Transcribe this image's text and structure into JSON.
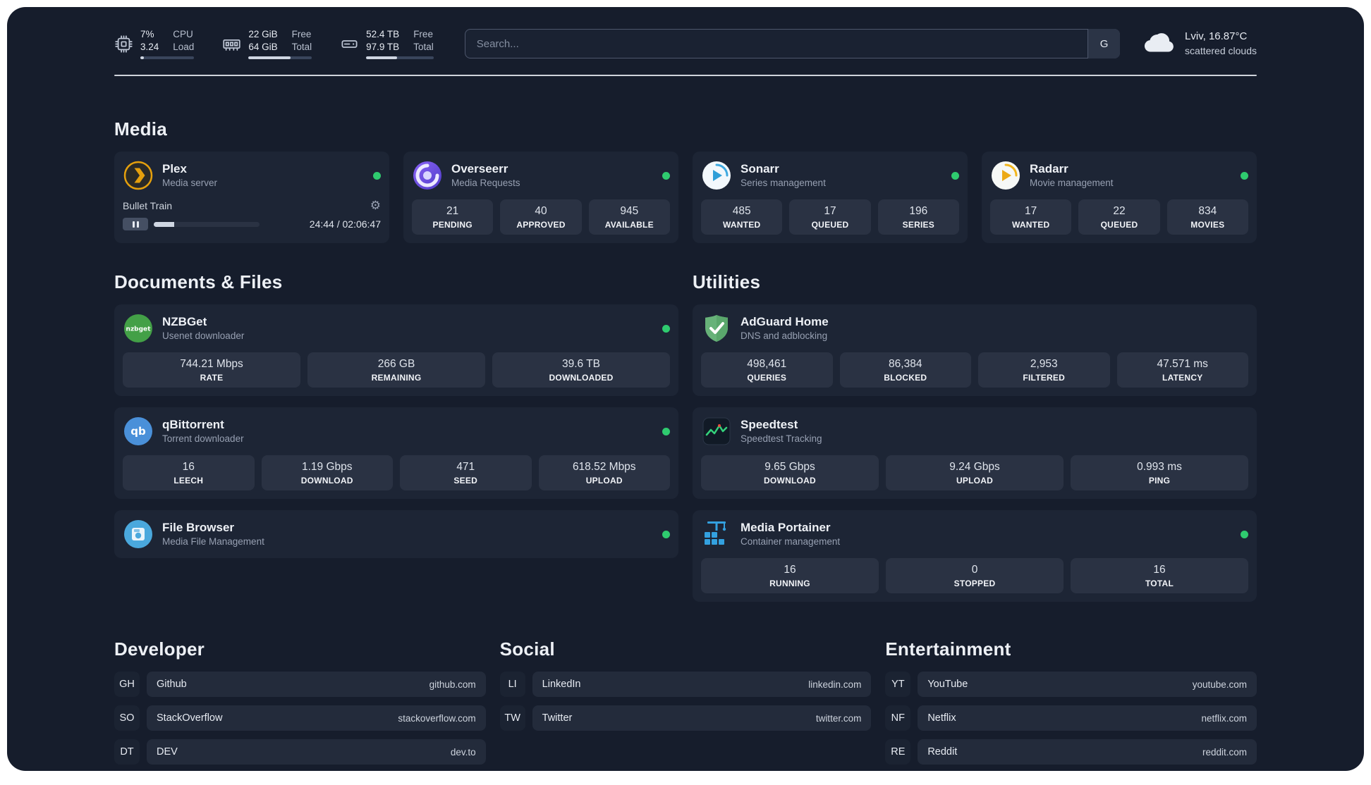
{
  "colors": {
    "background": "#161d2c",
    "card": "#1d2535",
    "tile": "#2a3243",
    "status_online": "#2fcb6f",
    "plex_accent": "#e5a00d",
    "divider": "#dfe3ea"
  },
  "topbar": {
    "resources": [
      {
        "value_top": "7%",
        "value_bottom": "3.24",
        "label_top": "CPU",
        "label_bottom": "Load",
        "progress": 7
      },
      {
        "value_top": "22 GiB",
        "value_bottom": "64 GiB",
        "label_top": "Free",
        "label_bottom": "Total",
        "progress": 66
      },
      {
        "value_top": "52.4 TB",
        "value_bottom": "97.9 TB",
        "label_top": "Free",
        "label_bottom": "Total",
        "progress": 46
      }
    ],
    "search": {
      "placeholder": "Search...",
      "provider_label": "G"
    },
    "weather": {
      "location": "Lviv, 16.87°C",
      "condition": "scattered clouds"
    }
  },
  "sections": {
    "media": {
      "title": "Media",
      "plex": {
        "name": "Plex",
        "desc": "Media server",
        "now_playing": {
          "title": "Bullet Train",
          "time": "24:44 / 02:06:47",
          "progress_percent": 19
        }
      },
      "overseerr": {
        "name": "Overseerr",
        "desc": "Media Requests",
        "stats": [
          {
            "value": "21",
            "label": "PENDING"
          },
          {
            "value": "40",
            "label": "APPROVED"
          },
          {
            "value": "945",
            "label": "AVAILABLE"
          }
        ]
      },
      "sonarr": {
        "name": "Sonarr",
        "desc": "Series management",
        "stats": [
          {
            "value": "485",
            "label": "WANTED"
          },
          {
            "value": "17",
            "label": "QUEUED"
          },
          {
            "value": "196",
            "label": "SERIES"
          }
        ]
      },
      "radarr": {
        "name": "Radarr",
        "desc": "Movie management",
        "stats": [
          {
            "value": "17",
            "label": "WANTED"
          },
          {
            "value": "22",
            "label": "QUEUED"
          },
          {
            "value": "834",
            "label": "MOVIES"
          }
        ]
      }
    },
    "documents": {
      "title": "Documents & Files",
      "nzbget": {
        "name": "NZBGet",
        "desc": "Usenet downloader",
        "stats": [
          {
            "value": "744.21 Mbps",
            "label": "RATE"
          },
          {
            "value": "266 GB",
            "label": "REMAINING"
          },
          {
            "value": "39.6 TB",
            "label": "DOWNLOADED"
          }
        ]
      },
      "qbittorrent": {
        "name": "qBittorrent",
        "desc": "Torrent downloader",
        "stats": [
          {
            "value": "16",
            "label": "LEECH"
          },
          {
            "value": "1.19 Gbps",
            "label": "DOWNLOAD"
          },
          {
            "value": "471",
            "label": "SEED"
          },
          {
            "value": "618.52 Mbps",
            "label": "UPLOAD"
          }
        ]
      },
      "filebrowser": {
        "name": "File Browser",
        "desc": "Media File Management"
      }
    },
    "utilities": {
      "title": "Utilities",
      "adguard": {
        "name": "AdGuard Home",
        "desc": "DNS and adblocking",
        "stats": [
          {
            "value": "498,461",
            "label": "QUERIES"
          },
          {
            "value": "86,384",
            "label": "BLOCKED"
          },
          {
            "value": "2,953",
            "label": "FILTERED"
          },
          {
            "value": "47.571 ms",
            "label": "LATENCY"
          }
        ]
      },
      "speedtest": {
        "name": "Speedtest",
        "desc": "Speedtest Tracking",
        "stats": [
          {
            "value": "9.65 Gbps",
            "label": "DOWNLOAD"
          },
          {
            "value": "9.24 Gbps",
            "label": "UPLOAD"
          },
          {
            "value": "0.993 ms",
            "label": "PING"
          }
        ]
      },
      "portainer": {
        "name": "Media Portainer",
        "desc": "Container management",
        "stats": [
          {
            "value": "16",
            "label": "RUNNING"
          },
          {
            "value": "0",
            "label": "STOPPED"
          },
          {
            "value": "16",
            "label": "TOTAL"
          }
        ]
      }
    }
  },
  "bookmarks": {
    "developer": {
      "title": "Developer",
      "items": [
        {
          "abbr": "GH",
          "name": "Github",
          "url": "github.com"
        },
        {
          "abbr": "SO",
          "name": "StackOverflow",
          "url": "stackoverflow.com"
        },
        {
          "abbr": "DT",
          "name": "DEV",
          "url": "dev.to"
        }
      ]
    },
    "social": {
      "title": "Social",
      "items": [
        {
          "abbr": "LI",
          "name": "LinkedIn",
          "url": "linkedin.com"
        },
        {
          "abbr": "TW",
          "name": "Twitter",
          "url": "twitter.com"
        }
      ]
    },
    "entertainment": {
      "title": "Entertainment",
      "items": [
        {
          "abbr": "YT",
          "name": "YouTube",
          "url": "youtube.com"
        },
        {
          "abbr": "NF",
          "name": "Netflix",
          "url": "netflix.com"
        },
        {
          "abbr": "RE",
          "name": "Reddit",
          "url": "reddit.com"
        }
      ]
    }
  }
}
